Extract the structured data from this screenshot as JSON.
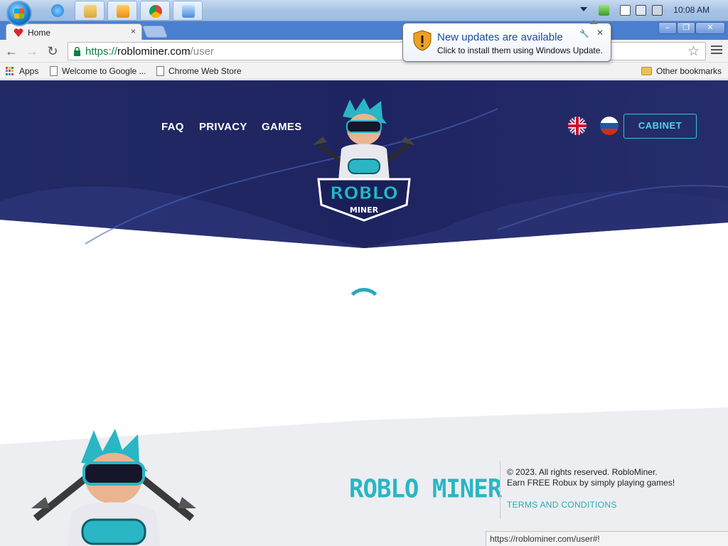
{
  "taskbar": {
    "clock": "10:08 AM",
    "apps": [
      "internet-explorer",
      "file-explorer",
      "media-player",
      "chrome",
      "remote-desktop"
    ]
  },
  "browser": {
    "tab_title": "Home",
    "tab_close": "×",
    "url_scheme": "https://",
    "url_host": "roblominer.com",
    "url_path": "/user",
    "window_controls": [
      "–",
      "❐",
      "✕"
    ]
  },
  "bookmarks": {
    "apps": "Apps",
    "items": [
      "Welcome to Google ...",
      "Chrome Web Store"
    ],
    "other": "Other bookmarks"
  },
  "notification": {
    "title": "New updates are available",
    "text": "Click to install them using Windows Update.",
    "close": "✕"
  },
  "site": {
    "nav": [
      "FAQ",
      "PRIVACY",
      "GAMES"
    ],
    "cabinet": "CABINET",
    "logo_text": [
      "ROBLO",
      "MINER"
    ],
    "footer_brand": "ROBLO MINER",
    "copyright": "© 2023. All rights reserved. RobloMiner.",
    "tagline": "Earn FREE Robux by simply playing games!",
    "terms": "TERMS AND CONDITIONS"
  },
  "status_bar": "https://roblominer.com/user#!",
  "colors": {
    "hero": "#1e2460",
    "accent": "#2ab6c4",
    "footer_bg": "#eceef1"
  }
}
